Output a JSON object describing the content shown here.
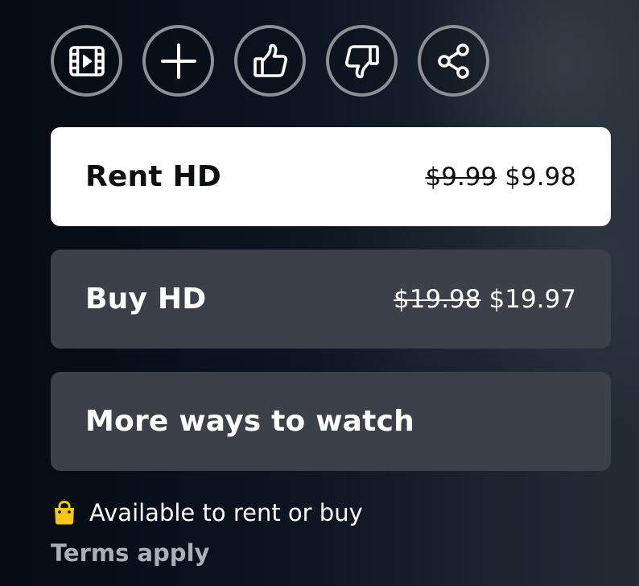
{
  "actions": [
    {
      "name": "trailer",
      "icon": "film-icon"
    },
    {
      "name": "add-to-watchlist",
      "icon": "plus-icon"
    },
    {
      "name": "like",
      "icon": "thumbs-up-icon"
    },
    {
      "name": "dislike",
      "icon": "thumbs-down-icon"
    },
    {
      "name": "share",
      "icon": "share-icon"
    }
  ],
  "options": {
    "rent": {
      "label": "Rent HD",
      "old_price": "$9.99",
      "price": "$9.98"
    },
    "buy": {
      "label": "Buy HD",
      "old_price": "$19.98",
      "price": "$19.97"
    },
    "more": {
      "label": "More ways to watch"
    }
  },
  "availability": {
    "icon": "shopping-bag-icon",
    "text": "Available to rent or buy",
    "terms": "Terms apply"
  },
  "colors": {
    "background": "#0a111c",
    "rent_button_bg": "#ffffff",
    "secondary_button_bg": "#3c4149",
    "bag_icon": "#f5c518",
    "terms_text": "#aab0b7"
  }
}
